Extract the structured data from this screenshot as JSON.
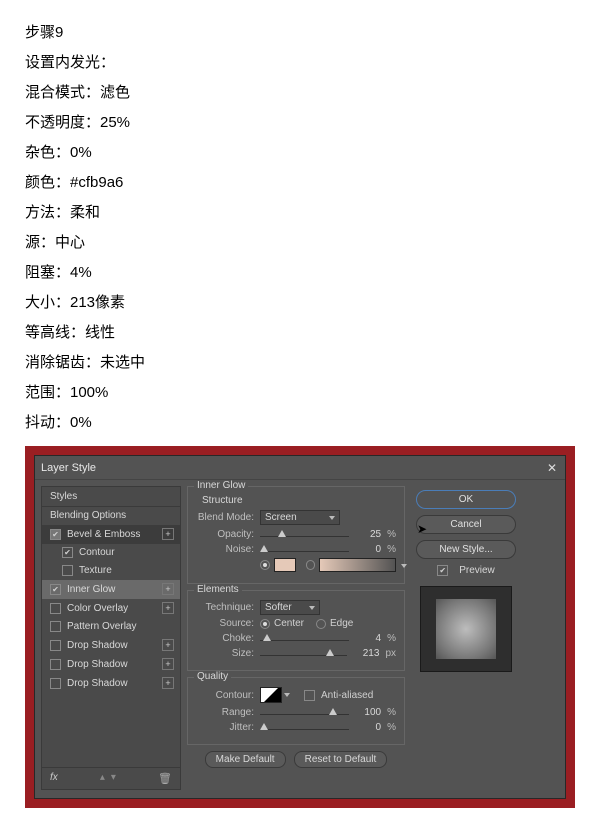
{
  "instructions": {
    "heading": "步骤9",
    "lines": [
      "设置内发光：",
      "混合模式：滤色",
      "不透明度：25%",
      "杂色：0%",
      "颜色：#cfb9a6",
      "方法：柔和",
      "源：中心",
      "阻塞：4%",
      "大小：213像素",
      "等高线：线性",
      "消除锯齿：未选中",
      "范围：100%",
      "抖动：0%"
    ]
  },
  "dialog": {
    "title": "Layer Style",
    "styles_header": "Styles",
    "blending_options": "Blending Options",
    "items": [
      {
        "label": "Bevel & Emboss",
        "checked": true,
        "indet": true
      },
      {
        "label": "Contour",
        "checked": true,
        "child": true
      },
      {
        "label": "Texture",
        "checked": false,
        "child": true
      },
      {
        "label": "Inner Glow",
        "checked": true,
        "selected": true
      },
      {
        "label": "Color Overlay",
        "checked": false,
        "plus": true
      },
      {
        "label": "Pattern Overlay",
        "checked": false
      },
      {
        "label": "Drop Shadow",
        "checked": false,
        "plus": true
      },
      {
        "label": "Drop Shadow",
        "checked": false,
        "plus": true
      },
      {
        "label": "Drop Shadow",
        "checked": false,
        "plus": true
      }
    ],
    "fx_label": "fx",
    "structure": {
      "section": "Inner Glow",
      "sub": "Structure",
      "blend_mode_label": "Blend Mode:",
      "blend_mode": "Screen",
      "opacity_label": "Opacity:",
      "opacity": "25",
      "noise_label": "Noise:",
      "noise": "0"
    },
    "elements": {
      "section": "Elements",
      "technique_label": "Technique:",
      "technique": "Softer",
      "source_label": "Source:",
      "center": "Center",
      "edge": "Edge",
      "choke_label": "Choke:",
      "choke": "4",
      "size_label": "Size:",
      "size": "213",
      "size_unit": "px"
    },
    "quality": {
      "section": "Quality",
      "contour_label": "Contour:",
      "aa_label": "Anti-aliased",
      "range_label": "Range:",
      "range": "100",
      "jitter_label": "Jitter:",
      "jitter": "0"
    },
    "make_default": "Make Default",
    "reset_default": "Reset to Default",
    "pct": "%"
  },
  "right": {
    "ok": "OK",
    "cancel": "Cancel",
    "new_style": "New Style...",
    "preview": "Preview"
  }
}
